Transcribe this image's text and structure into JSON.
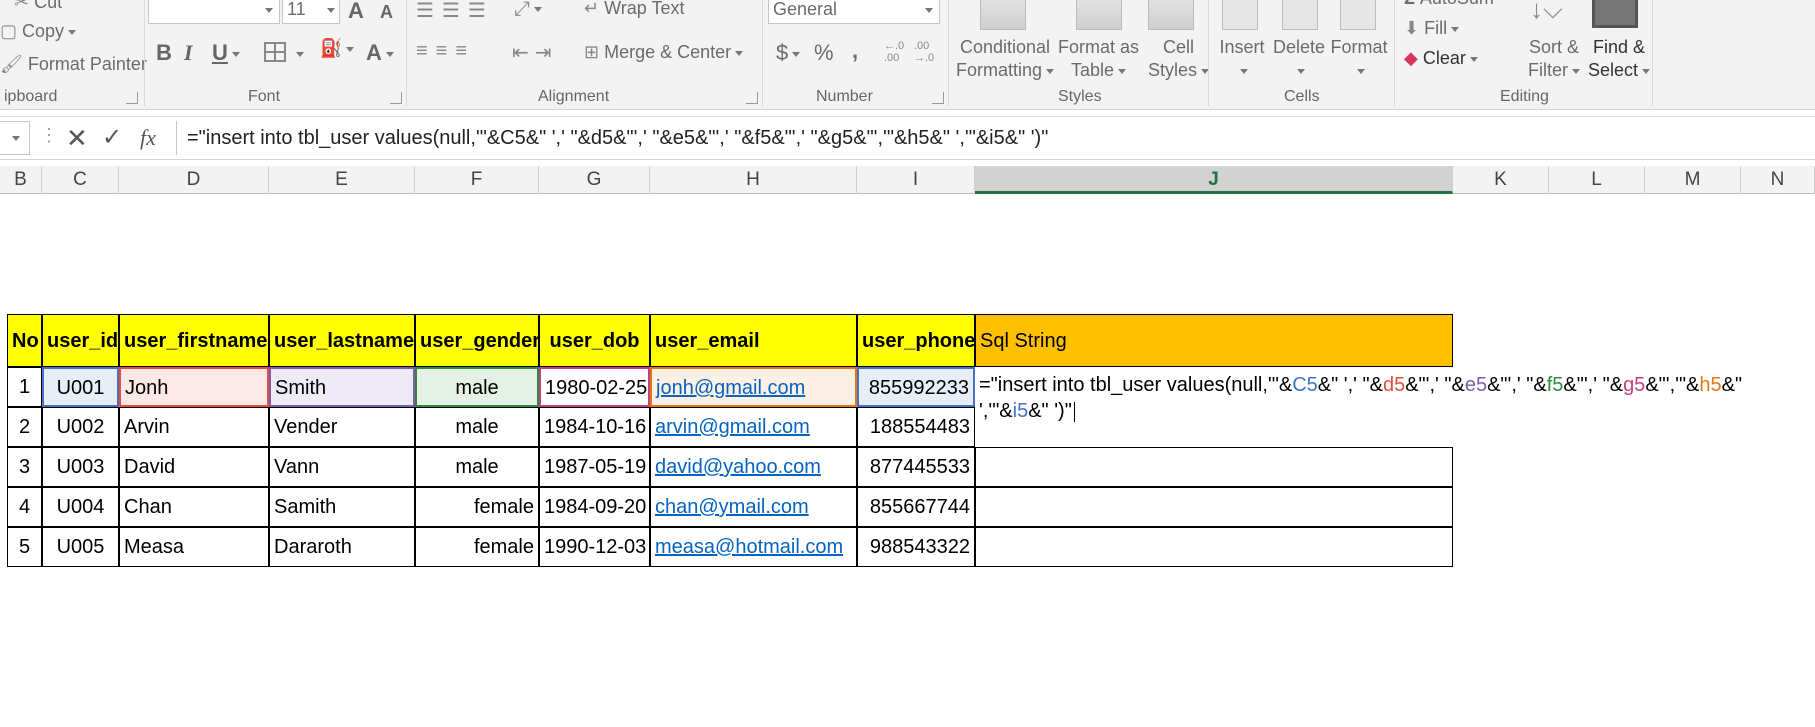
{
  "ribbon": {
    "clipboard": {
      "cut": "Cut",
      "copy": "Copy",
      "format_painter": "Format Painter",
      "title": "ipboard"
    },
    "font": {
      "size": "11",
      "grow": "A",
      "shrink": "A",
      "bold": "B",
      "italic": "I",
      "underline": "U",
      "font_color": "A",
      "title": "Font"
    },
    "alignment": {
      "wrap_text": "Wrap Text",
      "merge_center": "Merge & Center",
      "title": "Alignment"
    },
    "number": {
      "format": "General",
      "currency": "$",
      "percent": "%",
      "comma": ",",
      "inc_decimal": "←.0 .00",
      "dec_decimal": ".00 →.0",
      "title": "Number"
    },
    "styles": {
      "conditional": [
        "Conditional",
        "Formatting"
      ],
      "format_table": [
        "Format as",
        "Table"
      ],
      "cell_styles": [
        "Cell",
        "Styles"
      ],
      "title": "Styles"
    },
    "cells": {
      "insert": "Insert",
      "delete": "Delete",
      "format": "Format",
      "title": "Cells"
    },
    "editing": {
      "autosum": "AutoSum",
      "fill": "Fill",
      "clear": "Clear",
      "sort": [
        "Sort &",
        "Filter"
      ],
      "find": [
        "Find &",
        "Select"
      ],
      "title": "Editing"
    }
  },
  "formula_bar": {
    "formula": "=\"insert into tbl_user values(null,'\"&C5&\" ',' \"&d5&\"',' \"&e5&\"',' \"&f5&\"',' \"&g5&\"','\"&h5&\" ','\"&i5&\" ')\""
  },
  "columns": [
    "B",
    "C",
    "D",
    "E",
    "F",
    "G",
    "H",
    "I",
    "J",
    "K",
    "L",
    "M",
    "N"
  ],
  "table": {
    "headers": [
      "No",
      "user_id",
      "user_firstname",
      "user_lastname",
      "user_gender",
      "user_dob",
      "user_email",
      "user_phone",
      "Sql String"
    ],
    "rows": [
      [
        "1",
        "U001",
        "Jonh",
        "Smith",
        "male",
        "1980-02-25",
        "jonh@gmail.com",
        "855992233"
      ],
      [
        "2",
        "U002",
        "Arvin",
        "Vender",
        "male",
        "1984-10-16",
        "arvin@gmail.com",
        "188554483"
      ],
      [
        "3",
        "U003",
        "David",
        "Vann",
        "male",
        "1987-05-19",
        "david@yahoo.com",
        "877445533"
      ],
      [
        "4",
        "U004",
        "Chan",
        "Samith",
        "female",
        "1984-09-20",
        "chan@ymail.com",
        "855667744"
      ],
      [
        "5",
        "U005",
        "Measa",
        "Dararoth",
        "female",
        "1990-12-03",
        "measa@hotmail.com",
        "988543322"
      ]
    ],
    "edit_line1": [
      "=\"insert into tbl_user values(null,'\"&",
      "C5",
      "&\" ',' \"&",
      "d5",
      "&\"',' \"&",
      "e5",
      "&\"',' \"&",
      "f5",
      "&\"',' \"&",
      "g5",
      "&\"','\"&",
      "h5",
      "&\""
    ],
    "edit_line2": [
      "','\"&",
      "i5",
      "&\" ')\""
    ]
  },
  "colors": {
    "header_yellow": "#ffff00",
    "header_orange": "#ffc000",
    "link": "#0563c1",
    "excel_green": "#217346"
  }
}
